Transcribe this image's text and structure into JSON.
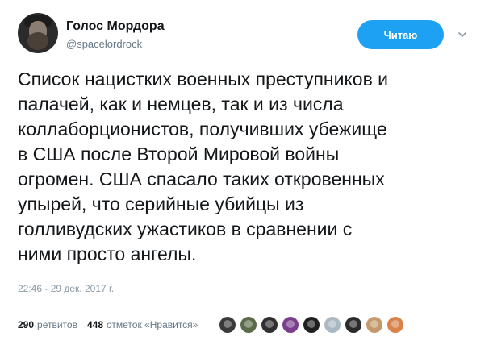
{
  "author": {
    "name": "Голос Мордора",
    "handle": "@spacelordrock"
  },
  "follow_button": {
    "label": "Читаю"
  },
  "tweet": {
    "text": "Список нацистких военных преступников и\nпалачей, как и немцев, так и из числа\nколлаборционистов, получивших убежище\nв США после Второй Мировой войны\nогромен. США спасало таких откровенных\nупырей, что серийные убийцы из\nголливудских ужастиков в сравнении с\nними просто ангелы.",
    "timestamp": "22:46 - 29 дек. 2017 г."
  },
  "stats": {
    "retweets_count": "290",
    "retweets_label": "ретвитов",
    "likes_count": "448",
    "likes_label": "отметок «Нравится»"
  },
  "likers": [
    {
      "icon": "user-avatar-icon",
      "color": "#3a3a3a"
    },
    {
      "icon": "user-avatar-icon",
      "color": "#5b6b4a"
    },
    {
      "icon": "user-avatar-icon",
      "color": "#2f2f2f"
    },
    {
      "icon": "user-avatar-icon",
      "color": "#7a3e8c"
    },
    {
      "icon": "user-avatar-icon",
      "color": "#1f1f1f"
    },
    {
      "icon": "user-avatar-icon",
      "color": "#aab8c2"
    },
    {
      "icon": "user-avatar-icon",
      "color": "#2b2b2b"
    },
    {
      "icon": "user-avatar-icon",
      "color": "#c49a6c"
    },
    {
      "icon": "user-avatar-icon",
      "color": "#d9824a"
    }
  ],
  "colors": {
    "accent": "#1da1f2",
    "text": "#14171a",
    "muted": "#657786"
  }
}
